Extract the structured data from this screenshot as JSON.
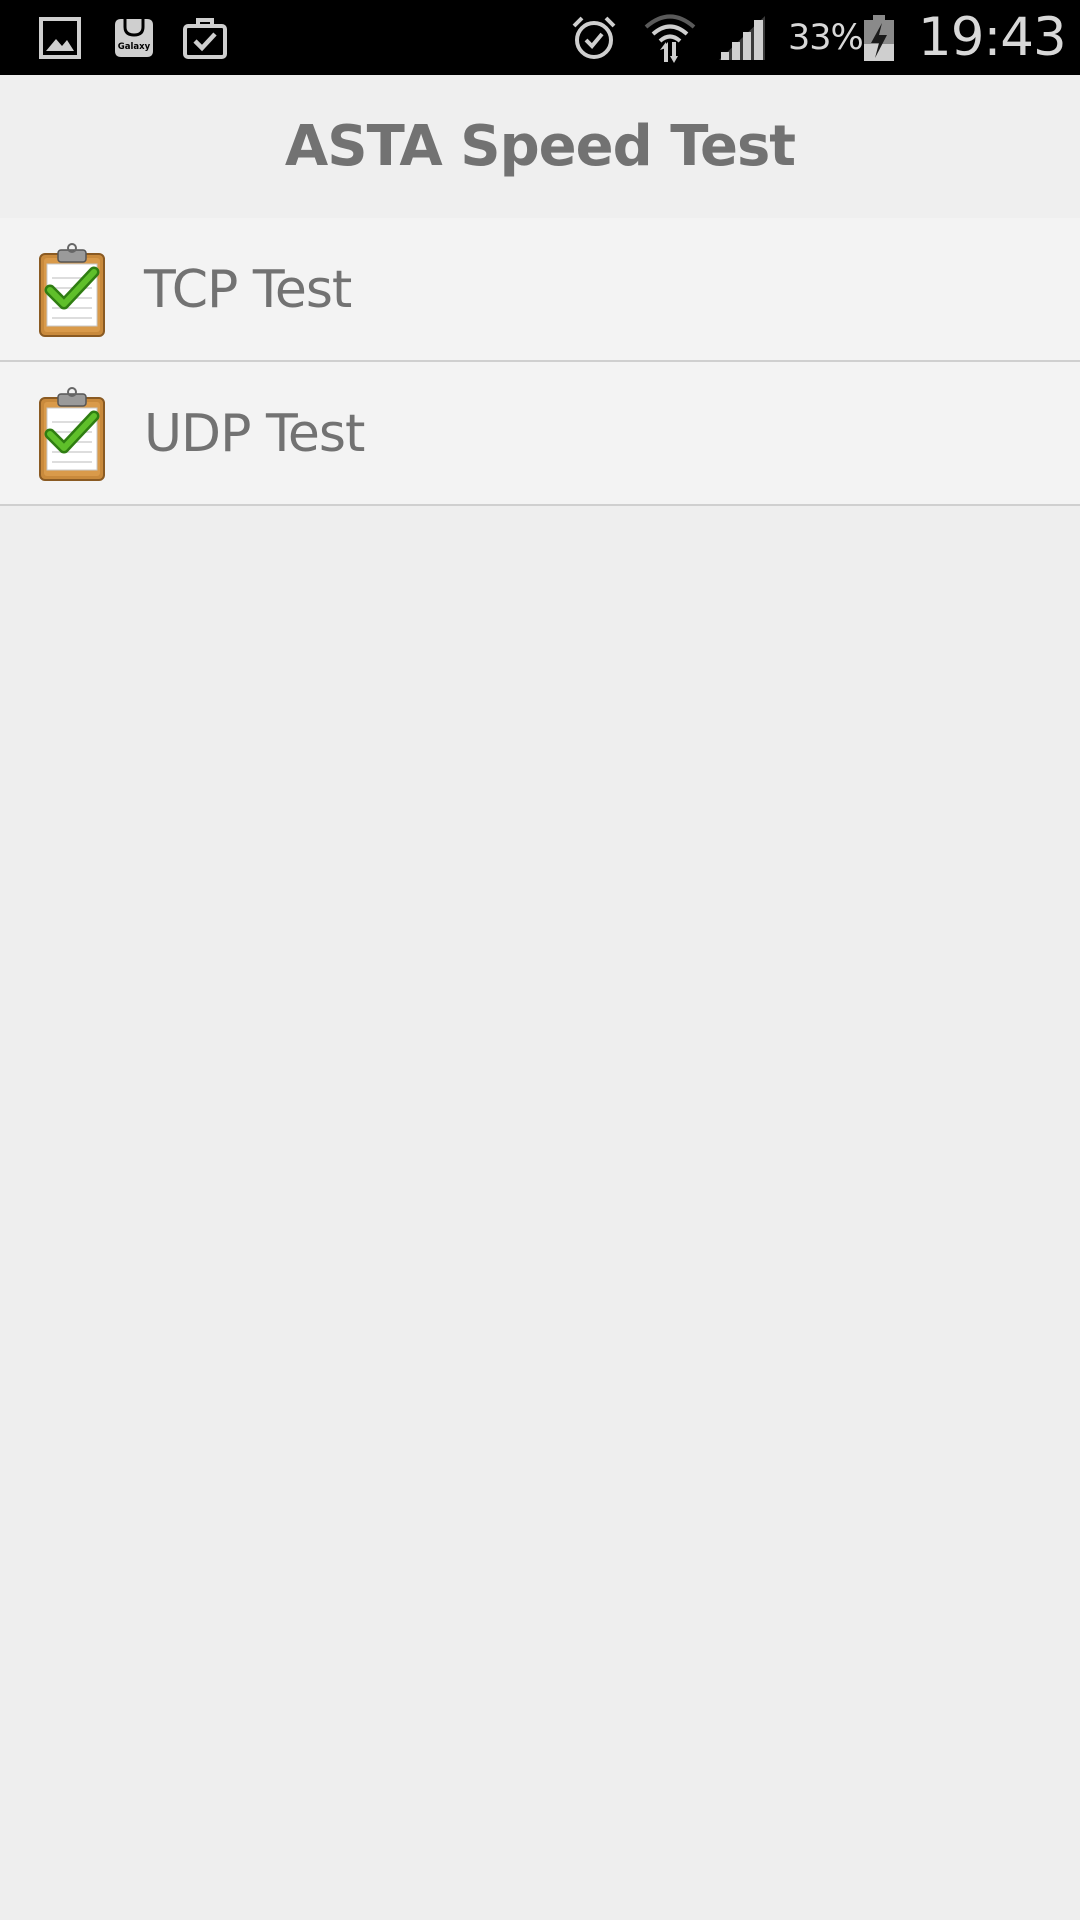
{
  "status_bar": {
    "left_icons": [
      "gallery-icon",
      "galaxy-apps-icon",
      "briefcase-check-icon"
    ],
    "galaxy_badge_text": "Galaxy",
    "right_icons": [
      "alarm-icon",
      "wifi-icon",
      "signal-icon",
      "battery-charging-icon"
    ],
    "battery_percent": "33%",
    "time": "19:43"
  },
  "app": {
    "title": "ASTA Speed Test"
  },
  "tests": [
    {
      "label": "TCP Test",
      "icon": "clipboard-check-icon"
    },
    {
      "label": "UDP Test",
      "icon": "clipboard-check-icon"
    }
  ],
  "colors": {
    "status_bar_bg": "#000000",
    "app_bg": "#eeeeee",
    "text_gray": "#727272",
    "check_green": "#3f9a1c",
    "clipboard_brown": "#c98a3c"
  }
}
